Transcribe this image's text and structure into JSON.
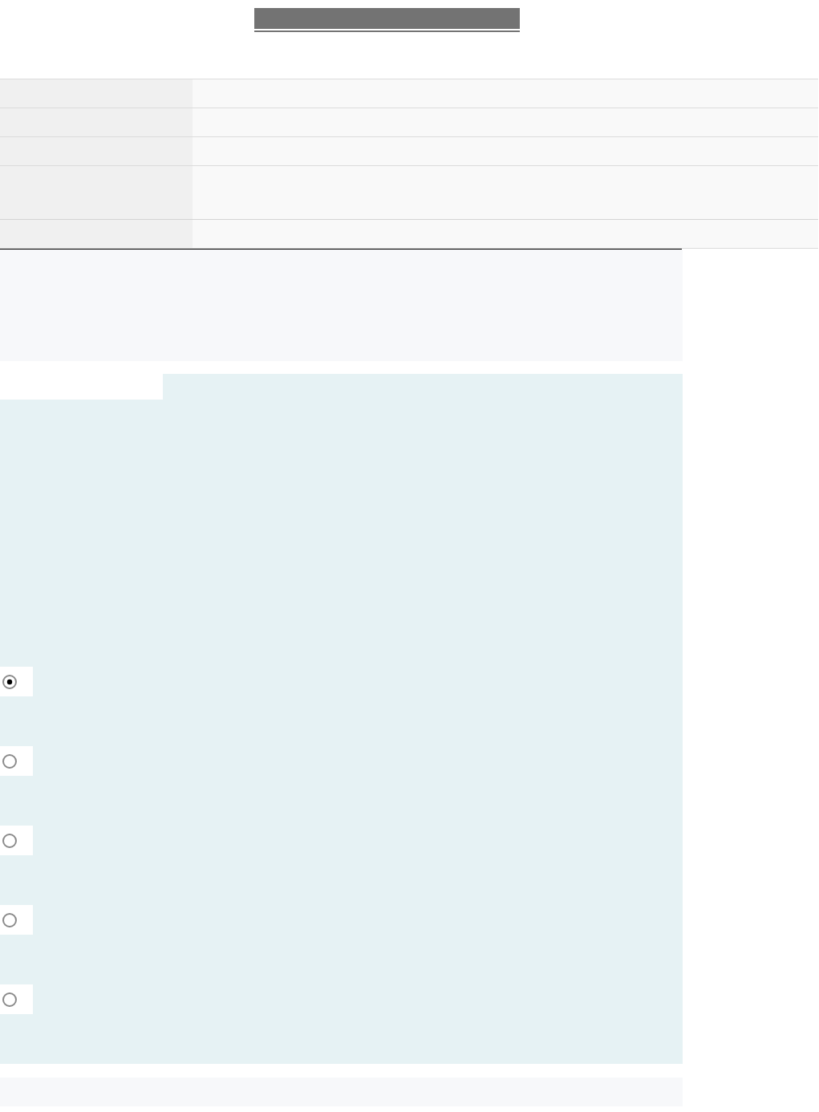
{
  "info_table": {
    "rows": [
      {
        "kind": "single"
      },
      {
        "kind": "single"
      },
      {
        "kind": "single"
      },
      {
        "kind": "tall"
      },
      {
        "kind": "single"
      }
    ]
  },
  "answer_options": [
    {
      "selected": true
    },
    {
      "selected": false
    },
    {
      "selected": false
    },
    {
      "selected": false
    },
    {
      "selected": false
    }
  ]
}
